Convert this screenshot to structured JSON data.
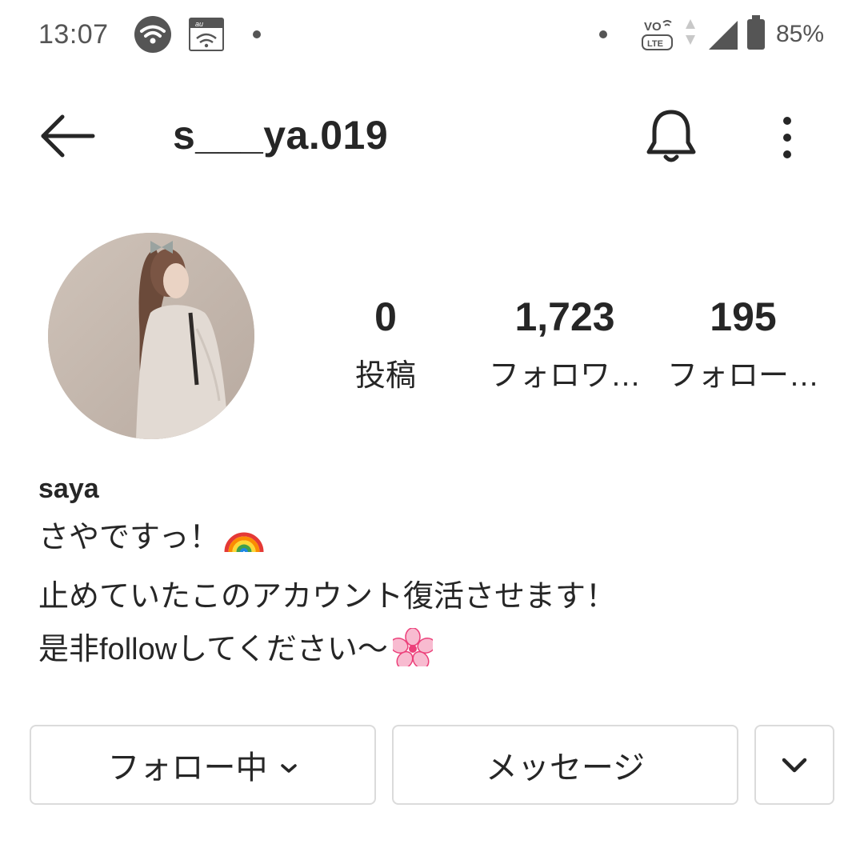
{
  "status_bar": {
    "time": "13:07",
    "battery": "85%",
    "icons": [
      "wifi-icon",
      "au-carrier-icon",
      "volte-icon",
      "data-arrows-icon",
      "signal-icon",
      "battery-icon"
    ]
  },
  "header": {
    "username": "s___ya.019",
    "icons": [
      "back-arrow-icon",
      "bell-icon",
      "more-vertical-icon"
    ]
  },
  "stats": [
    {
      "value": "0",
      "label": "投稿"
    },
    {
      "value": "1,723",
      "label": "フォロワ…"
    },
    {
      "value": "195",
      "label": "フォロー…"
    }
  ],
  "profile": {
    "display_name": "saya",
    "bio_lines": [
      "さやですっ！",
      "止めていたこのアカウント復活させます！",
      "是非followしてください〜"
    ],
    "bio_emojis": [
      "rainbow-emoji",
      "cherry-blossom-emoji"
    ]
  },
  "actions": {
    "follow_label": "フォロー中",
    "message_label": "メッセージ"
  },
  "colors": {
    "text": "#262626",
    "border": "#dbdbdb",
    "status_gray": "#555555"
  }
}
